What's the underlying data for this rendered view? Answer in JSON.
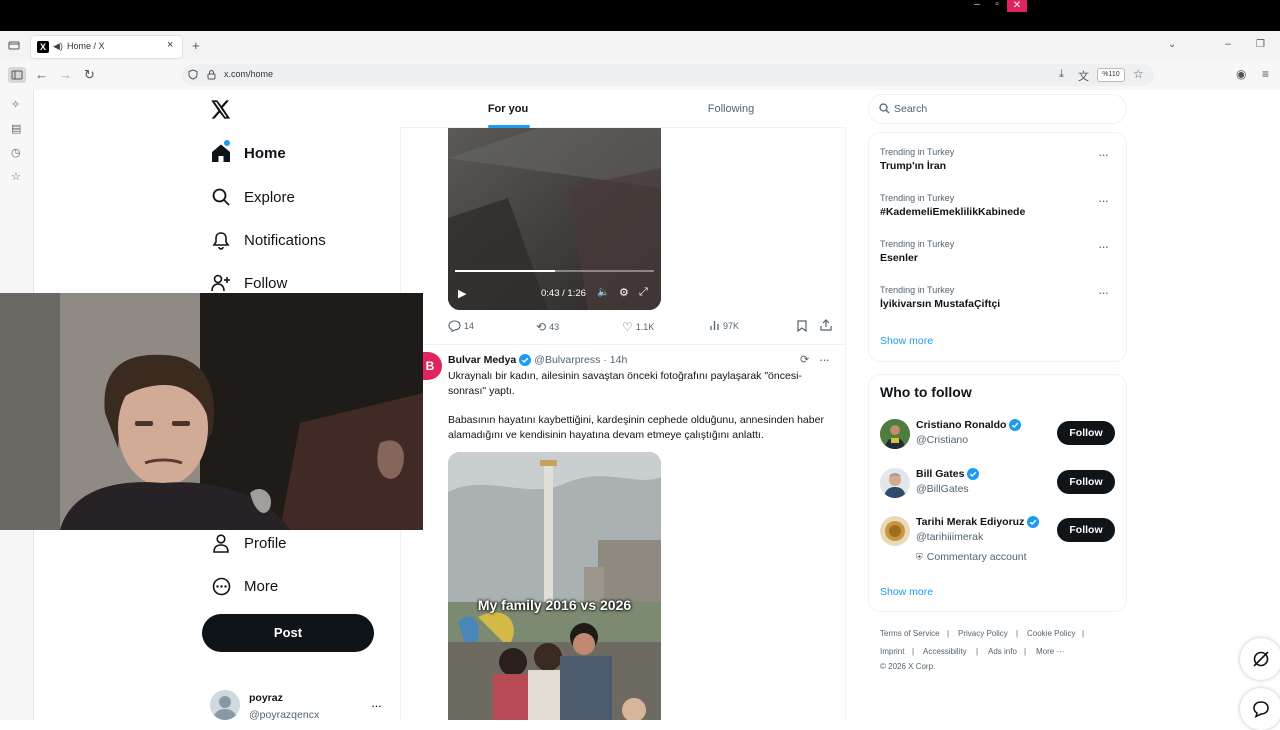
{
  "browser": {
    "tab_title": "Home / X",
    "url": "x.com/home",
    "zoom": "%110"
  },
  "nav": {
    "items": [
      {
        "label": "Home",
        "icon": "home-icon"
      },
      {
        "label": "Explore",
        "icon": "search-icon"
      },
      {
        "label": "Notifications",
        "icon": "bell-icon"
      },
      {
        "label": "Follow",
        "icon": "add-person-icon"
      },
      {
        "label": "Profile",
        "icon": "person-icon"
      },
      {
        "label": "More",
        "icon": "more-circle-icon"
      }
    ],
    "post_label": "Post",
    "account": {
      "name": "poyraz",
      "handle": "@poyrazqencx"
    }
  },
  "feed": {
    "tabs": [
      {
        "label": "For you",
        "active": true
      },
      {
        "label": "Following",
        "active": false
      }
    ],
    "video1": {
      "time": "0:43 / 1:26",
      "progress": 0.5
    },
    "actions1": {
      "replies": "14",
      "reposts": "43",
      "likes": "1.1K",
      "views": "97K"
    },
    "tweet": {
      "author": "Bulvar Medya",
      "handle": "@Bulvarpress",
      "time": "· 14h",
      "text1": "Ukraynalı bir kadın, ailesinin savaştan önceki fotoğrafını paylaşarak \"öncesi-sonrası\" yaptı.",
      "text2": "Babasının hayatını kaybettiğini, kardeşinin cephede olduğunu, annesinden haber alamadığını ve kendisinin hayatına devam etmeye çalıştığını anlattı.",
      "image_caption": "My family 2016 vs 2026"
    }
  },
  "search": {
    "placeholder": "Search"
  },
  "trends": [
    {
      "context": "Trending in Turkey",
      "name": "Trump'ın İran"
    },
    {
      "context": "Trending in Turkey",
      "name": "#KademeliEmeklilikKabinede"
    },
    {
      "context": "Trending in Turkey",
      "name": "Esenler"
    },
    {
      "context": "Trending in Turkey",
      "name": "İyikivarsın MustafaÇiftçi"
    }
  ],
  "trends_show_more": "Show more",
  "who_to_follow": {
    "title": "Who to follow",
    "accounts": [
      {
        "name": "Cristiano Ronaldo",
        "handle": "@Cristiano",
        "button": "Follow"
      },
      {
        "name": "Bill Gates",
        "handle": "@BillGates",
        "button": "Follow"
      },
      {
        "name": "Tarihi Merak Ediyoruz",
        "handle": "@tarihiiimerak",
        "button": "Follow",
        "badge": "Commentary account"
      }
    ],
    "show_more": "Show more"
  },
  "footer": {
    "links": [
      "Terms of Service",
      "Privacy Policy",
      "Cookie Policy",
      "Imprint",
      "Accessibility",
      "Ads info",
      "More ···"
    ],
    "copyright": "© 2026 X Corp."
  },
  "colors": {
    "accent": "#1d9bf0",
    "text": "#0f1419",
    "muted": "#536471",
    "brand_red": "#e0245e"
  }
}
